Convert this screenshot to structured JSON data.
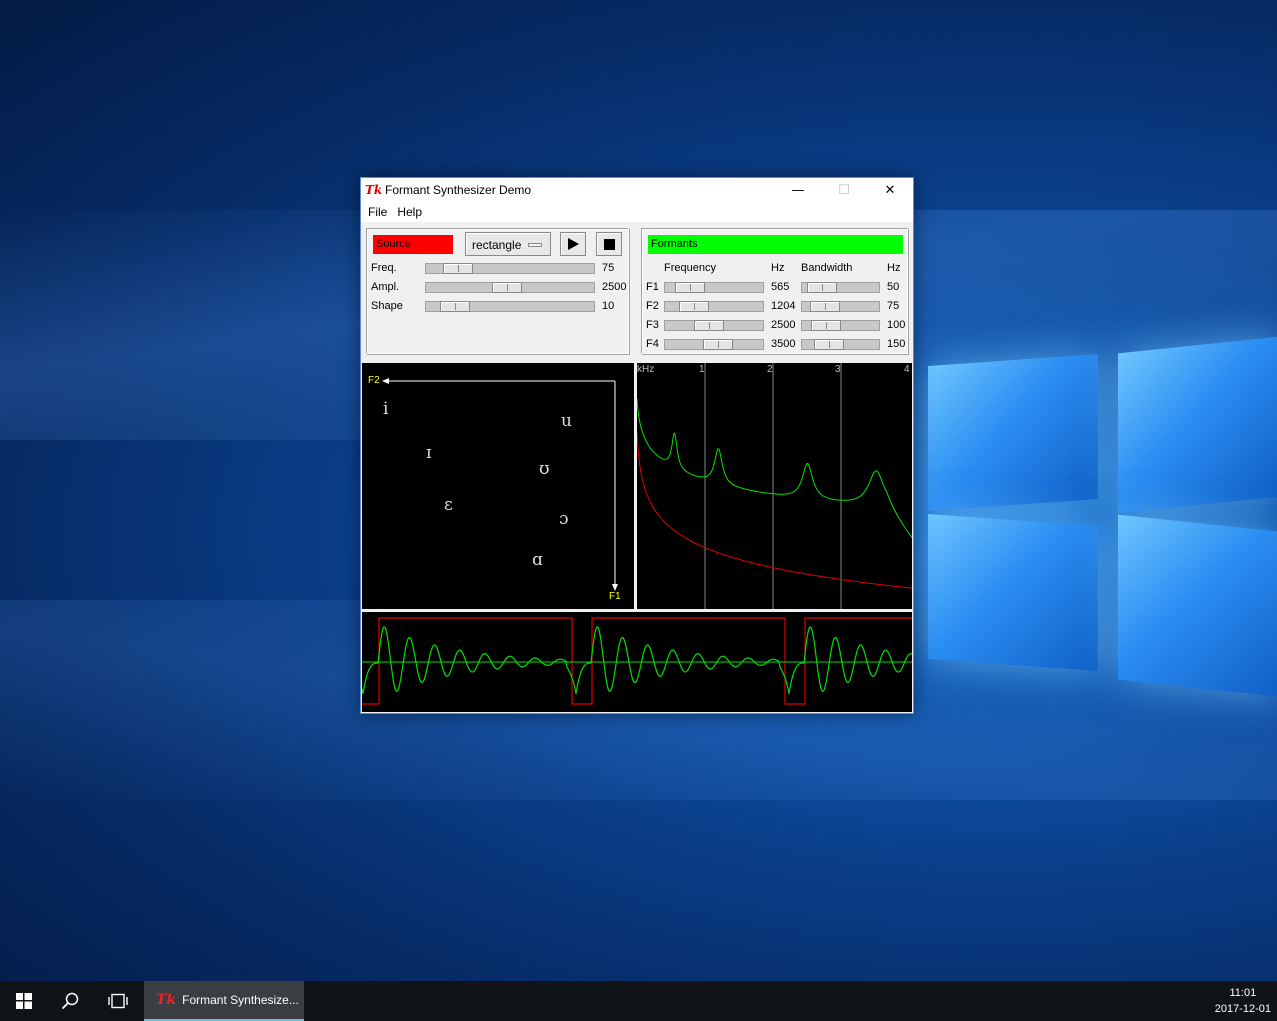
{
  "window": {
    "title": "Formant Synthesizer Demo",
    "logo": "Tk",
    "controls": {
      "minimize": "—",
      "maximize": "☐",
      "close": "✕"
    }
  },
  "menu": {
    "file": "File",
    "help": "Help"
  },
  "source": {
    "label": "Source",
    "label_color": "#ff0000",
    "waveform": "rectangle",
    "rows": [
      {
        "name": "Freq.",
        "value": "75",
        "level": 0.12
      },
      {
        "name": "Ampl.",
        "value": "2500",
        "level": 0.48
      },
      {
        "name": "Shape",
        "value": "10",
        "level": 0.1
      }
    ]
  },
  "formants": {
    "label": "Formants",
    "label_color": "#00ff00",
    "headers": {
      "frequency": "Frequency",
      "hz1": "Hz",
      "bandwidth": "Bandwidth",
      "hz2": "Hz"
    },
    "rows": [
      {
        "name": "F1",
        "freq": "565",
        "freq_level": 0.14,
        "bw": "50",
        "bw_level": 0.1
      },
      {
        "name": "F2",
        "freq": "1204",
        "freq_level": 0.2,
        "bw": "75",
        "bw_level": 0.16
      },
      {
        "name": "F3",
        "freq": "2500",
        "freq_level": 0.42,
        "bw": "100",
        "bw_level": 0.2
      },
      {
        "name": "F4",
        "freq": "3500",
        "freq_level": 0.56,
        "bw": "150",
        "bw_level": 0.26
      }
    ]
  },
  "vowel_chart": {
    "x_axis": "F2",
    "y_axis": "F1",
    "vowels": [
      "i",
      "u",
      "ɪ",
      "ʊ",
      "ɛ",
      "ɔ",
      "ɑ"
    ]
  },
  "spectrum": {
    "unit": "kHz",
    "ticks": [
      "1",
      "2",
      "3",
      "4"
    ],
    "colors": {
      "envelope": "#00e000",
      "source": "#e00000"
    }
  },
  "waveform": {
    "colors": {
      "output": "#00e000",
      "pulse": "#e00000"
    }
  },
  "taskbar": {
    "start_icon": "windows-start-icon",
    "search_icon": "search-icon",
    "taskview_icon": "task-view-icon",
    "app_label": "Formant Synthesize...",
    "time": "11:01",
    "date": "2017-12-01"
  }
}
